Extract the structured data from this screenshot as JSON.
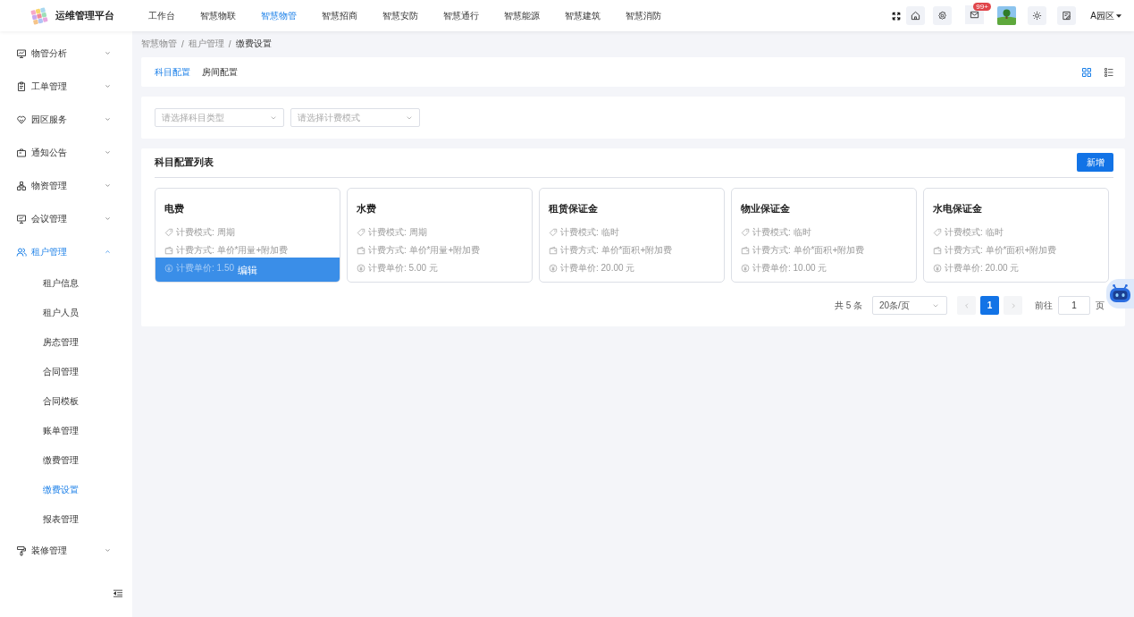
{
  "header": {
    "title": "运维管理平台",
    "nav": [
      {
        "label": "工作台",
        "selected": false
      },
      {
        "label": "智慧物联",
        "selected": false
      },
      {
        "label": "智慧物管",
        "selected": true
      },
      {
        "label": "智慧招商",
        "selected": false
      },
      {
        "label": "智慧安防",
        "selected": false
      },
      {
        "label": "智慧通行",
        "selected": false
      },
      {
        "label": "智慧能源",
        "selected": false
      },
      {
        "label": "智慧建筑",
        "selected": false
      },
      {
        "label": "智慧消防",
        "selected": false
      }
    ],
    "mail_badge": "99+",
    "park": "A园区"
  },
  "sidebar": {
    "items": [
      {
        "label": "物管分析",
        "expanded": false
      },
      {
        "label": "工单管理",
        "expanded": false
      },
      {
        "label": "园区服务",
        "expanded": false
      },
      {
        "label": "通知公告",
        "expanded": false
      },
      {
        "label": "物资管理",
        "expanded": false
      },
      {
        "label": "会议管理",
        "expanded": false
      },
      {
        "label": "租户管理",
        "expanded": true,
        "children": [
          {
            "label": "租户信息",
            "selected": false
          },
          {
            "label": "租户人员",
            "selected": false
          },
          {
            "label": "房态管理",
            "selected": false
          },
          {
            "label": "合同管理",
            "selected": false
          },
          {
            "label": "合同模板",
            "selected": false
          },
          {
            "label": "账单管理",
            "selected": false
          },
          {
            "label": "缴费管理",
            "selected": false
          },
          {
            "label": "缴费设置",
            "selected": true
          },
          {
            "label": "报表管理",
            "selected": false
          }
        ]
      },
      {
        "label": "装修管理",
        "expanded": false
      }
    ]
  },
  "breadcrumb": {
    "separator": "/",
    "items": [
      "智慧物管",
      "租户管理",
      "缴费设置"
    ]
  },
  "tabs": [
    {
      "label": "科目配置",
      "selected": true
    },
    {
      "label": "房间配置",
      "selected": false
    }
  ],
  "view_toggle": [
    {
      "selected": true
    },
    {
      "selected": false
    }
  ],
  "filters": [
    {
      "placeholder": "请选择科目类型"
    },
    {
      "placeholder": "请选择计费模式"
    }
  ],
  "subject_list": {
    "title": "科目配置列表",
    "add_button": "新增",
    "cards": [
      {
        "title": "电费",
        "mode": "计费模式: 周期",
        "method": "计费方式: 单价*用量+附加费",
        "price": "计费单价: 1.50",
        "hover_action": "编辑"
      },
      {
        "title": "水费",
        "mode": "计费模式: 周期",
        "method": "计费方式: 单价*用量+附加费",
        "price": "计费单价: 5.00 元"
      },
      {
        "title": "租赁保证金",
        "mode": "计费模式: 临时",
        "method": "计费方式: 单价*面积+附加费",
        "price": "计费单价: 20.00 元"
      },
      {
        "title": "物业保证金",
        "mode": "计费模式: 临时",
        "method": "计费方式: 单价*面积+附加费",
        "price": "计费单价: 10.00 元"
      },
      {
        "title": "水电保证金",
        "mode": "计费模式: 临时",
        "method": "计费方式: 单价*面积+附加费",
        "price": "计费单价: 20.00 元"
      }
    ]
  },
  "pagination": {
    "total": "共 5 条",
    "page_size": "20条/页",
    "pages": [
      {
        "label": "1",
        "selected": true
      }
    ],
    "goto_label": "前往",
    "goto_value": "1",
    "goto_suffix": "页"
  }
}
